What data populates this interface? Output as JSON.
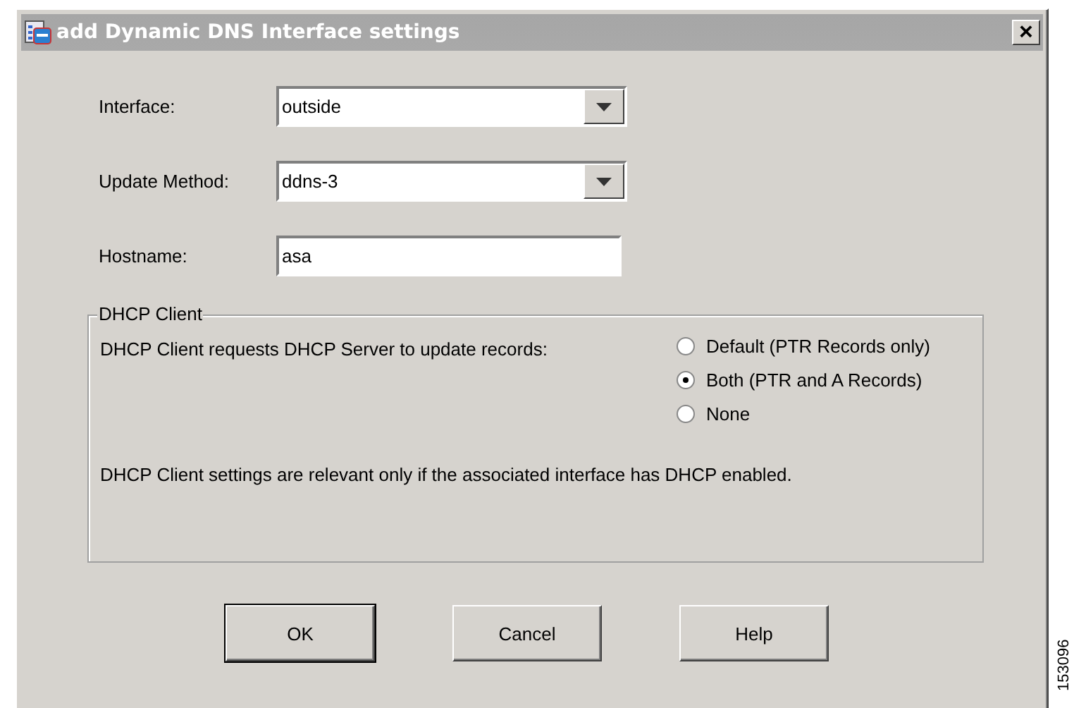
{
  "window": {
    "title": "add Dynamic DNS Interface settings",
    "close": "×"
  },
  "fields": [
    {
      "kind": "combo",
      "label": "Interface:",
      "value": "outside"
    },
    {
      "kind": "combo",
      "label": "Update Method:",
      "value": "ddns-3"
    },
    {
      "kind": "text",
      "label": "Hostname:",
      "value": "asa"
    }
  ],
  "group": {
    "title": "DHCP Client",
    "prompt": "DHCP Client requests DHCP Server to update records:",
    "options": [
      {
        "label": "Default (PTR Records only)",
        "selected": false
      },
      {
        "label": "Both (PTR  and A Records)",
        "selected": true
      },
      {
        "label": "None",
        "selected": false
      }
    ],
    "note": "DHCP Client settings are relevant only if the associated interface has DHCP enabled."
  },
  "buttons": [
    "OK",
    "Cancel",
    "Help"
  ],
  "side_label": "153096"
}
